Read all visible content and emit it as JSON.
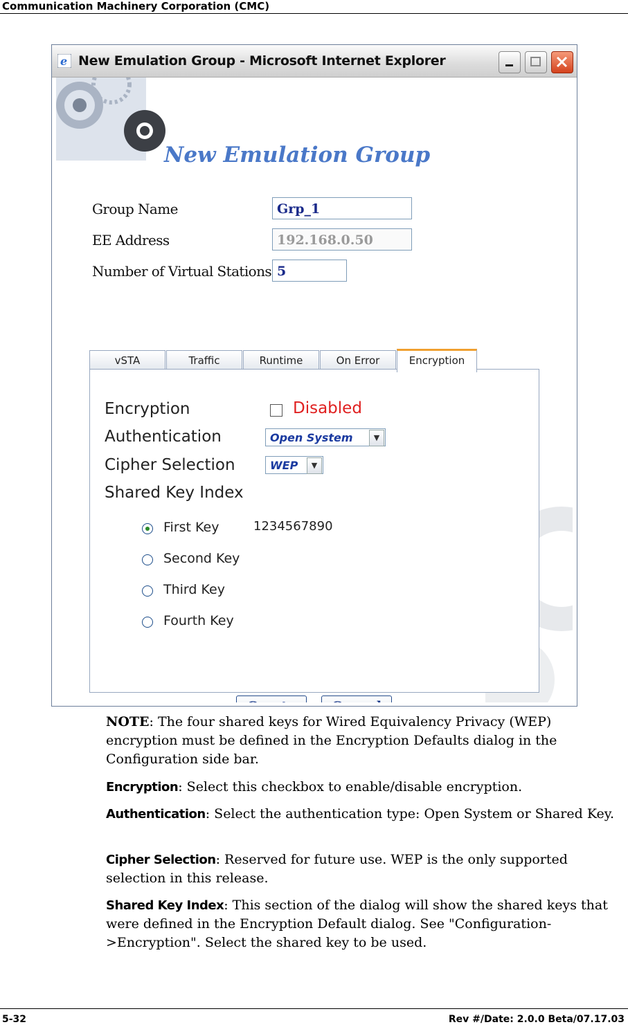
{
  "header": {
    "title": "Communication Machinery Corporation (CMC)"
  },
  "footer": {
    "page_number": "5-32",
    "revision": "Rev #/Date: 2.0.0 Beta/07.17.03"
  },
  "window": {
    "title": "New Emulation Group - Microsoft Internet Explorer"
  },
  "dialog": {
    "heading": "New Emulation Group",
    "fields": {
      "group_name_label": "Group Name",
      "group_name_value": "Grp_1",
      "ee_address_label": "EE Address",
      "ee_address_value": "192.168.0.50",
      "virtual_stations_label": "Number of Virtual Stations",
      "virtual_stations_value": "5"
    },
    "tabs": [
      "vSTA",
      "Traffic",
      "Runtime",
      "On Error",
      "Encryption"
    ],
    "active_tab": "Encryption",
    "encryption": {
      "encryption_label": "Encryption",
      "encryption_checked": false,
      "encryption_status": "Disabled",
      "authentication_label": "Authentication",
      "authentication_value": "Open System",
      "cipher_label": "Cipher Selection",
      "cipher_value": "WEP",
      "shared_key_label": "Shared Key Index",
      "keys": [
        {
          "label": "First Key",
          "value": "1234567890",
          "selected": true
        },
        {
          "label": "Second Key",
          "value": "",
          "selected": false
        },
        {
          "label": "Third Key",
          "value": "",
          "selected": false
        },
        {
          "label": "Fourth Key",
          "value": "",
          "selected": false
        }
      ]
    },
    "buttons": {
      "create": "Create",
      "cancel": "Cancel"
    }
  },
  "paragraphs": {
    "note_term": "NOTE",
    "note_text": ": The four shared keys for Wired Equivalency Privacy (WEP) encryption must be defined in the Encryption Defaults dialog in the Configuration side bar.",
    "encryption_term": "Encryption",
    "encryption_text": ": Select this checkbox to enable/disable encryption.",
    "authentication_term": "Authentication",
    "authentication_text": ": Select the authentication type: Open System or Shared Key.",
    "cipher_term": "Cipher Selection",
    "cipher_text": ": Reserved for future use. WEP is the only supported selection in this release.",
    "shared_key_term": "Shared Key Index",
    "shared_key_text": ": This section of the dialog will show the shared keys that were defined in the Encryption Default dialog. See \"Configuration->Encryption\". Select the shared key to be used."
  }
}
